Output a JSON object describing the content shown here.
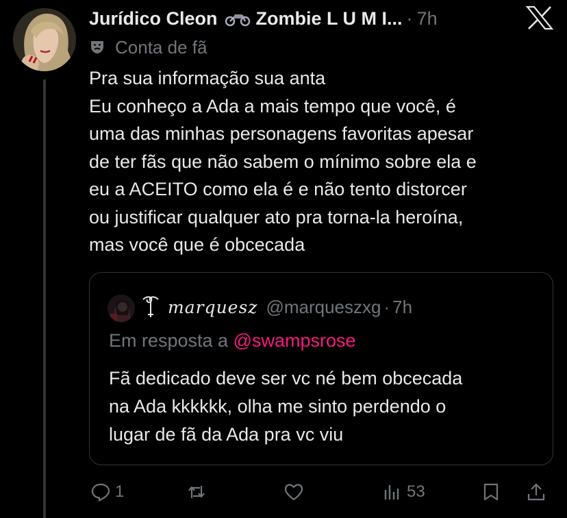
{
  "author": {
    "name": "Jurídico Cleon",
    "name_suffix": "Zombie L U M I...",
    "separator": "·",
    "time": "7h",
    "badge_label": "Conta de fã"
  },
  "post": {
    "lines": [
      "Pra sua informação sua anta",
      "Eu conheço a Ada a mais tempo que você, é",
      "uma das minhas personagens favoritas apesar",
      "de ter fãs que não sabem o mínimo sobre ela e",
      "eu a ACEITO como ela é e não tento distorcer",
      "ou justificar qualquer ato pra torna-la heroína,",
      "mas você que é obcecada"
    ]
  },
  "quote": {
    "display_name": "marquesz",
    "handle": "@marqueszxg",
    "separator": "·",
    "time": "7h",
    "reply_prefix": "Em resposta a",
    "reply_mention": "@swampsrose",
    "lines": [
      "Fã dedicado deve ser vc né bem obcecada",
      "na Ada kkkkkk, olha me sinto perdendo o",
      "lugar de fã da Ada pra vc viu"
    ]
  },
  "actions": {
    "replies": "1",
    "retweets": "",
    "likes": "",
    "views": "53"
  },
  "colors": {
    "background": "#000000",
    "text": "#e7e9ea",
    "muted": "#71767b",
    "mention": "#f91880",
    "border": "#2f3336"
  },
  "icons": [
    "x-logo-icon",
    "motorcycle-icon",
    "theater-mask-icon",
    "reply-icon",
    "retweet-icon",
    "like-icon",
    "views-icon",
    "bookmark-icon",
    "share-icon"
  ]
}
